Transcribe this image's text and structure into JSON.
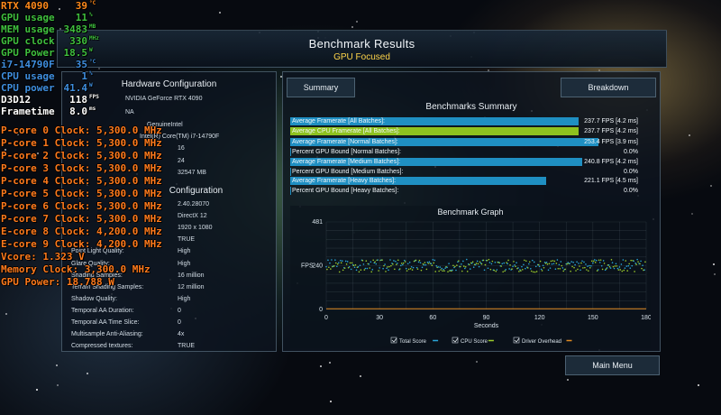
{
  "header": {
    "title": "Benchmark Results",
    "subtitle": "GPU Focused"
  },
  "hardware": {
    "title": "Hardware Configuration",
    "rows": [
      {
        "label": "",
        "value": "NVIDIA GeForce RTX 4090"
      },
      {
        "label": "",
        "value": "NA"
      },
      {
        "label": "",
        "value": "GenuineIntel"
      },
      {
        "label": "",
        "value": "Intel(R) Core(TM) i7-14790F"
      },
      {
        "label": "",
        "value": "16"
      },
      {
        "label": "",
        "value": "24"
      },
      {
        "label": "",
        "value": "32547 MB"
      }
    ]
  },
  "game_config": {
    "title": "Configuration",
    "rows": [
      {
        "label": "",
        "value": "2.40.28070"
      },
      {
        "label": "",
        "value": "DirectX 12"
      },
      {
        "label": "",
        "value": "1920 x 1080"
      },
      {
        "label": "",
        "value": "TRUE"
      },
      {
        "label": "Point Light Quality:",
        "value": "High"
      },
      {
        "label": "Glare Quality:",
        "value": "High"
      },
      {
        "label": "Shading Samples:",
        "value": "16 million"
      },
      {
        "label": "Terrain Shading Samples:",
        "value": "12 million"
      },
      {
        "label": "Shadow Quality:",
        "value": "High"
      },
      {
        "label": "Temporal AA Duration:",
        "value": "0"
      },
      {
        "label": "Temporal AA Time Slice:",
        "value": "0"
      },
      {
        "label": "Multisample Anti-Aliasing:",
        "value": "4x"
      },
      {
        "label": "Compressed textures:",
        "value": "TRUE"
      }
    ]
  },
  "tabs": {
    "summary": "Summary",
    "breakdown": "Breakdown"
  },
  "summary": {
    "title": "Benchmarks Summary",
    "rows": [
      {
        "label": "Average Framerate [All Batches]:",
        "value": "237.7 FPS [4.2 ms]",
        "fill": 0.89,
        "color": "#1f8fc2"
      },
      {
        "label": "Average CPU Framerate [All Batches]:",
        "value": "237.7 FPS [4.2 ms]",
        "fill": 0.89,
        "color": "#8ec21f"
      },
      {
        "label": "Average Framerate [Normal Batches]:",
        "value": "253.4 FPS [3.9 ms]",
        "fill": 0.95,
        "color": "#1f8fc2"
      },
      {
        "label": "Percent GPU Bound [Normal Batches]:",
        "value": "0.0%",
        "fill": 0.0,
        "color": "#1f8fc2"
      },
      {
        "label": "Average Framerate [Medium Batches]:",
        "value": "240.8 FPS [4.2 ms]",
        "fill": 0.9,
        "color": "#1f8fc2"
      },
      {
        "label": "Percent GPU Bound [Medium Batches]:",
        "value": "0.0%",
        "fill": 0.0,
        "color": "#1f8fc2"
      },
      {
        "label": "Average Framerate [Heavy Batches]:",
        "value": "221.1 FPS [4.5 ms]",
        "fill": 0.79,
        "color": "#1f8fc2"
      },
      {
        "label": "Percent GPU Bound [Heavy Batches]:",
        "value": "0.0%",
        "fill": 0.0,
        "color": "#1f8fc2"
      }
    ]
  },
  "graph": {
    "title": "Benchmark Graph",
    "ylabel": "FPS",
    "xlabel": "Seconds",
    "y_ticks": [
      "481",
      "240",
      "0"
    ],
    "x_ticks": [
      "0",
      "30",
      "60",
      "90",
      "120",
      "150",
      "180"
    ],
    "legend": [
      {
        "label": "Total Score",
        "color": "#2aa6d8"
      },
      {
        "label": "CPU Score",
        "color": "#9ccc2a"
      },
      {
        "label": "Driver Overhead",
        "color": "#e08a20"
      }
    ]
  },
  "main_menu": "Main Menu",
  "osd": [
    {
      "key": "RTX 4090",
      "value": "39",
      "unit": "°C",
      "color": "#ff8a1c"
    },
    {
      "key": "GPU usage",
      "value": "11",
      "unit": "%",
      "color": "#3fc03f"
    },
    {
      "key": "MEM usage",
      "value": "3483",
      "unit": "MB",
      "color": "#3fc03f"
    },
    {
      "key": "GPU clock",
      "value": "330",
      "unit": "MHz",
      "color": "#3fc03f"
    },
    {
      "key": "GPU Power",
      "value": "18.5",
      "unit": "W",
      "color": "#3fc03f"
    },
    {
      "key": "i7-14790F",
      "value": "35",
      "unit": "°C",
      "color": "#3f8fe0"
    },
    {
      "key": "CPU usage",
      "value": "1",
      "unit": "%",
      "color": "#3f8fe0"
    },
    {
      "key": "CPU power",
      "value": "41.4",
      "unit": "W",
      "color": "#3f8fe0"
    },
    {
      "key": "D3D12",
      "value": "118",
      "unit": "FPS",
      "color": "#ffffff"
    },
    {
      "key": "Frametime",
      "value": "8.0",
      "unit": "ms",
      "color": "#ffffff"
    }
  ],
  "osd_clocks": [
    "P-core 0 Clock: 5,300.0 MHz",
    "P-core 1 Clock: 5,300.0 MHz",
    "P-core 2 Clock: 5,300.0 MHz",
    "P-core 3 Clock: 5,300.0 MHz",
    "P-core 4 Clock: 5,300.0 MHz",
    "P-core 5 Clock: 5,300.0 MHz",
    "P-core 6 Clock: 5,300.0 MHz",
    "P-core 7 Clock: 5,300.0 MHz",
    "E-core 8 Clock: 4,200.0 MHz",
    "E-core 9 Clock: 4,200.0 MHz",
    "Vcore: 1.323 V",
    "Memory Clock: 3,300.0 MHz",
    "GPU Power: 18.788 W"
  ],
  "osd_clock_color": "#ff7a1c"
}
